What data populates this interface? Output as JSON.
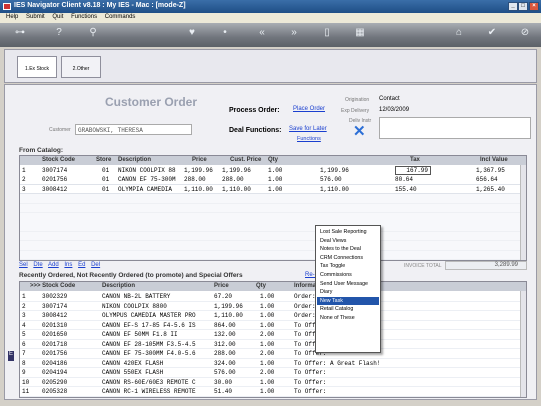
{
  "window": {
    "title": "IES Navigator Client v8.18 : My IES - Mac :        [mode-Z]",
    "min": "_",
    "max": "□",
    "close": "×"
  },
  "menu": [
    "Help",
    "Submit",
    "Quit",
    "Functions",
    "Commands"
  ],
  "tabs": [
    {
      "label": "1.Ex Stock"
    },
    {
      "label": "2.Other"
    }
  ],
  "header": {
    "page_title": "Customer Order",
    "customer_label": "Customer",
    "customer_value": "GRABOWSKI, THERESA",
    "process_label": "Process Order:",
    "process_link": "Place Order",
    "deal_label": "Deal Functions:",
    "deal_link": "Save for Later",
    "deal_link2": "Functions",
    "origination_label": "Origination",
    "origination_value": "Contact",
    "expdelivery_label": "Exp Delivery",
    "expdelivery_value": "12/03/2009",
    "delivinstr_label": "Deliv Instr"
  },
  "catalog": {
    "title": "From Catalog:",
    "columns": [
      "Stock Code",
      "Store",
      "Description",
      "Price",
      "Cust. Price",
      "Qty",
      "Tax",
      "Incl Value"
    ],
    "rows": [
      {
        "n": "1",
        "code": "3007174",
        "store": "01",
        "desc": "NIKON COOLPIX 88",
        "price": "1,199.96",
        "cprice": "1,199.96",
        "qty": "1.00",
        "amt": "1,199.96",
        "tax": "167.99",
        "incl": "1,367.95"
      },
      {
        "n": "2",
        "code": "0201756",
        "store": "01",
        "desc": "CANON EF 75-300M",
        "price": "288.00",
        "cprice": "288.00",
        "qty": "1.00",
        "amt": "576.00",
        "tax": "80.64",
        "incl": "656.64"
      },
      {
        "n": "3",
        "code": "3008412",
        "store": "01",
        "desc": "OLYMPIA CAMEDIA",
        "price": "1,110.00",
        "cprice": "1,110.00",
        "qty": "1.00",
        "amt": "1,110.00",
        "tax": "155.40",
        "incl": "1,265.40"
      }
    ],
    "actions": [
      "Sel",
      "Dte",
      "Add",
      "Ins",
      "Ed",
      "Del"
    ],
    "invoice_total_label": "INVOICE TOTAL",
    "invoice_total": "3,289.99"
  },
  "context_menu": {
    "items": [
      "Lost Sale Reporting",
      "Deal Views",
      "Notes to the Deal",
      "CRM Connections",
      "Tax Toggle",
      "Commissions",
      "Send User Message",
      "Diary",
      "New Task",
      "Retail Catalog",
      "None of These"
    ],
    "selected": "New Task"
  },
  "recent": {
    "title": "Recently Ordered, Not Recently Ordered (to promote) and Special Offers",
    "resort_link": "Re-Sort",
    "columns": [
      ">>> Stock Code",
      "Description",
      "Price",
      "Qty",
      "Information"
    ],
    "rows": [
      {
        "n": "1",
        "code": "3002329",
        "desc": "CANON NB-2L BATTERY",
        "price": "67.20",
        "qty": "1.00",
        "info": "Order: 09/03/09"
      },
      {
        "n": "2",
        "code": "3007174",
        "desc": "NIKON COOLPIX 8800",
        "price": "1,199.96",
        "qty": "1.00",
        "info": "Order: 09/03/09"
      },
      {
        "n": "3",
        "code": "3008412",
        "desc": "OLYMPUS CAMEDIA MASTER PRO",
        "price": "1,110.00",
        "qty": "1.00",
        "info": "Order: 06/03/09"
      },
      {
        "n": "4",
        "code": "0201310",
        "desc": "CANON EF-S 17-85 F4-5.6 IS",
        "price": "864.00",
        "qty": "1.00",
        "info": "To Offer:"
      },
      {
        "n": "5",
        "code": "0201650",
        "desc": "CANON EF 50MM F1.8 II",
        "price": "132.00",
        "qty": "2.00",
        "info": "To Offer:"
      },
      {
        "n": "6",
        "code": "0201718",
        "desc": "CANON EF 28-105MM F3.5-4.5",
        "price": "312.00",
        "qty": "1.00",
        "info": "To Offer:"
      },
      {
        "n": "7",
        "code": "0201756",
        "desc": "CANON EF 75-300MM F4.0-5.6",
        "price": "288.00",
        "qty": "2.00",
        "info": "To Offer:"
      },
      {
        "n": "8",
        "code": "0204186",
        "desc": "CANON 420EX FLASH",
        "price": "324.00",
        "qty": "1.00",
        "info": "To Offer: A Great Flash!"
      },
      {
        "n": "9",
        "code": "0204194",
        "desc": "CANON 550EX FLASH",
        "price": "576.00",
        "qty": "2.00",
        "info": "To Offer:"
      },
      {
        "n": "10",
        "code": "0205290",
        "desc": "CANON RS-60E/60E3 REMOTE C",
        "price": "30.00",
        "qty": "1.00",
        "info": "To Offer:"
      },
      {
        "n": "11",
        "code": "0205328",
        "desc": "CANON RC-1 WIRELESS REMOTE",
        "price": "51.40",
        "qty": "1.00",
        "info": "To Offer:"
      }
    ]
  },
  "colors": {
    "selected": "#2255aa",
    "link": "#1a3fcf",
    "title": "#9aa0b0"
  }
}
